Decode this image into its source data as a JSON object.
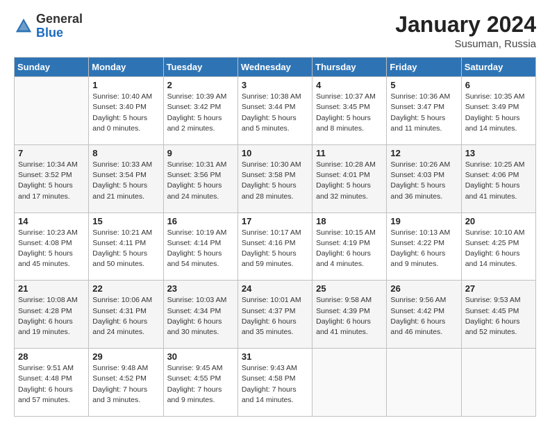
{
  "header": {
    "logo_general": "General",
    "logo_blue": "Blue",
    "month_title": "January 2024",
    "location": "Susuman, Russia"
  },
  "weekdays": [
    "Sunday",
    "Monday",
    "Tuesday",
    "Wednesday",
    "Thursday",
    "Friday",
    "Saturday"
  ],
  "weeks": [
    [
      {
        "day": "",
        "info": ""
      },
      {
        "day": "1",
        "info": "Sunrise: 10:40 AM\nSunset: 3:40 PM\nDaylight: 5 hours\nand 0 minutes."
      },
      {
        "day": "2",
        "info": "Sunrise: 10:39 AM\nSunset: 3:42 PM\nDaylight: 5 hours\nand 2 minutes."
      },
      {
        "day": "3",
        "info": "Sunrise: 10:38 AM\nSunset: 3:44 PM\nDaylight: 5 hours\nand 5 minutes."
      },
      {
        "day": "4",
        "info": "Sunrise: 10:37 AM\nSunset: 3:45 PM\nDaylight: 5 hours\nand 8 minutes."
      },
      {
        "day": "5",
        "info": "Sunrise: 10:36 AM\nSunset: 3:47 PM\nDaylight: 5 hours\nand 11 minutes."
      },
      {
        "day": "6",
        "info": "Sunrise: 10:35 AM\nSunset: 3:49 PM\nDaylight: 5 hours\nand 14 minutes."
      }
    ],
    [
      {
        "day": "7",
        "info": "Sunrise: 10:34 AM\nSunset: 3:52 PM\nDaylight: 5 hours\nand 17 minutes."
      },
      {
        "day": "8",
        "info": "Sunrise: 10:33 AM\nSunset: 3:54 PM\nDaylight: 5 hours\nand 21 minutes."
      },
      {
        "day": "9",
        "info": "Sunrise: 10:31 AM\nSunset: 3:56 PM\nDaylight: 5 hours\nand 24 minutes."
      },
      {
        "day": "10",
        "info": "Sunrise: 10:30 AM\nSunset: 3:58 PM\nDaylight: 5 hours\nand 28 minutes."
      },
      {
        "day": "11",
        "info": "Sunrise: 10:28 AM\nSunset: 4:01 PM\nDaylight: 5 hours\nand 32 minutes."
      },
      {
        "day": "12",
        "info": "Sunrise: 10:26 AM\nSunset: 4:03 PM\nDaylight: 5 hours\nand 36 minutes."
      },
      {
        "day": "13",
        "info": "Sunrise: 10:25 AM\nSunset: 4:06 PM\nDaylight: 5 hours\nand 41 minutes."
      }
    ],
    [
      {
        "day": "14",
        "info": "Sunrise: 10:23 AM\nSunset: 4:08 PM\nDaylight: 5 hours\nand 45 minutes."
      },
      {
        "day": "15",
        "info": "Sunrise: 10:21 AM\nSunset: 4:11 PM\nDaylight: 5 hours\nand 50 minutes."
      },
      {
        "day": "16",
        "info": "Sunrise: 10:19 AM\nSunset: 4:14 PM\nDaylight: 5 hours\nand 54 minutes."
      },
      {
        "day": "17",
        "info": "Sunrise: 10:17 AM\nSunset: 4:16 PM\nDaylight: 5 hours\nand 59 minutes."
      },
      {
        "day": "18",
        "info": "Sunrise: 10:15 AM\nSunset: 4:19 PM\nDaylight: 6 hours\nand 4 minutes."
      },
      {
        "day": "19",
        "info": "Sunrise: 10:13 AM\nSunset: 4:22 PM\nDaylight: 6 hours\nand 9 minutes."
      },
      {
        "day": "20",
        "info": "Sunrise: 10:10 AM\nSunset: 4:25 PM\nDaylight: 6 hours\nand 14 minutes."
      }
    ],
    [
      {
        "day": "21",
        "info": "Sunrise: 10:08 AM\nSunset: 4:28 PM\nDaylight: 6 hours\nand 19 minutes."
      },
      {
        "day": "22",
        "info": "Sunrise: 10:06 AM\nSunset: 4:31 PM\nDaylight: 6 hours\nand 24 minutes."
      },
      {
        "day": "23",
        "info": "Sunrise: 10:03 AM\nSunset: 4:34 PM\nDaylight: 6 hours\nand 30 minutes."
      },
      {
        "day": "24",
        "info": "Sunrise: 10:01 AM\nSunset: 4:37 PM\nDaylight: 6 hours\nand 35 minutes."
      },
      {
        "day": "25",
        "info": "Sunrise: 9:58 AM\nSunset: 4:39 PM\nDaylight: 6 hours\nand 41 minutes."
      },
      {
        "day": "26",
        "info": "Sunrise: 9:56 AM\nSunset: 4:42 PM\nDaylight: 6 hours\nand 46 minutes."
      },
      {
        "day": "27",
        "info": "Sunrise: 9:53 AM\nSunset: 4:45 PM\nDaylight: 6 hours\nand 52 minutes."
      }
    ],
    [
      {
        "day": "28",
        "info": "Sunrise: 9:51 AM\nSunset: 4:48 PM\nDaylight: 6 hours\nand 57 minutes."
      },
      {
        "day": "29",
        "info": "Sunrise: 9:48 AM\nSunset: 4:52 PM\nDaylight: 7 hours\nand 3 minutes."
      },
      {
        "day": "30",
        "info": "Sunrise: 9:45 AM\nSunset: 4:55 PM\nDaylight: 7 hours\nand 9 minutes."
      },
      {
        "day": "31",
        "info": "Sunrise: 9:43 AM\nSunset: 4:58 PM\nDaylight: 7 hours\nand 14 minutes."
      },
      {
        "day": "",
        "info": ""
      },
      {
        "day": "",
        "info": ""
      },
      {
        "day": "",
        "info": ""
      }
    ]
  ]
}
